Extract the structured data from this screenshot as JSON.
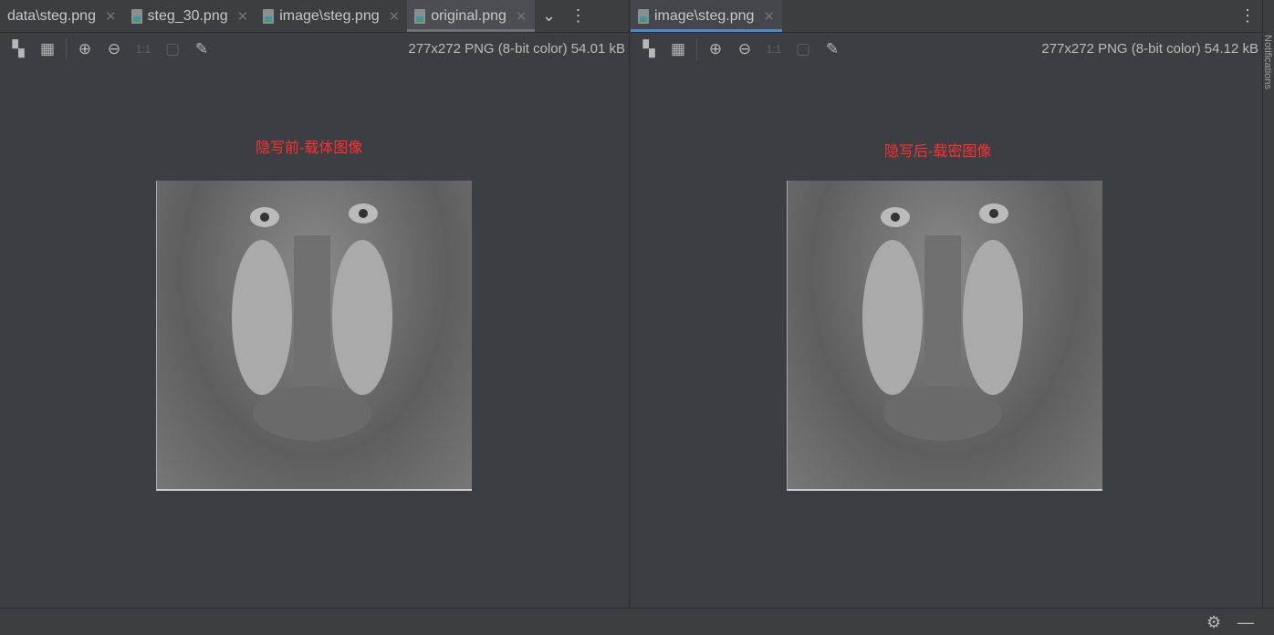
{
  "left": {
    "tabs": [
      {
        "label": "data\\steg.png",
        "icon": false
      },
      {
        "label": "steg_30.png",
        "icon": true
      },
      {
        "label": "image\\steg.png",
        "icon": true
      },
      {
        "label": "original.png",
        "icon": true,
        "active": true
      }
    ],
    "info": "277x272 PNG (8-bit color) 54.01 kB",
    "caption": "隐写前-载体图像",
    "actual_size": "1:1"
  },
  "right": {
    "tabs": [
      {
        "label": "image\\steg.png",
        "icon": true,
        "active": true
      }
    ],
    "info": "277x272 PNG (8-bit color) 54.12 kB",
    "caption": "隐写后-载密图像",
    "actual_size": "1:1"
  },
  "notifications": "Notifications"
}
